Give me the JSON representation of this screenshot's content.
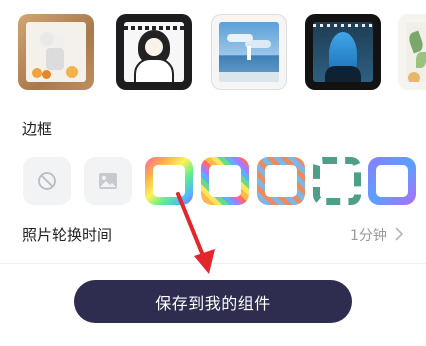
{
  "frames_section": {
    "label": "边框",
    "option_icons": [
      "ban-icon",
      "image-icon"
    ]
  },
  "rotation_setting": {
    "label": "照片轮换时间",
    "value": "1分钟",
    "icon": "chevron-right-icon"
  },
  "save_button": {
    "label": "保存到我的组件"
  },
  "colors": {
    "button_bg": "#2e2c4f",
    "arrow": "#e3262b",
    "text": "#222222",
    "muted": "#9a9a9a"
  }
}
